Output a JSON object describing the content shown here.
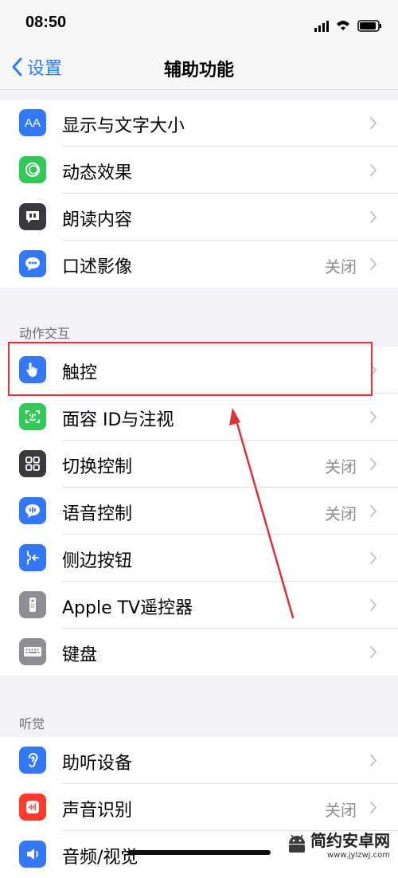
{
  "status": {
    "time": "08:50"
  },
  "nav": {
    "back_label": "设置",
    "title": "辅助功能"
  },
  "vision": {
    "items": [
      {
        "label": "显示与文字大小",
        "value": "",
        "icon": "text-size-icon",
        "color": "#3478f6"
      },
      {
        "label": "动态效果",
        "value": "",
        "icon": "motion-icon",
        "color": "#34c759"
      },
      {
        "label": "朗读内容",
        "value": "",
        "icon": "speech-icon",
        "color": "#3a3a3c"
      },
      {
        "label": "口述影像",
        "value": "关闭",
        "icon": "audio-description-icon",
        "color": "#3478f6"
      }
    ]
  },
  "motor": {
    "header": "动作交互",
    "items": [
      {
        "label": "触控",
        "value": "",
        "icon": "touch-hand-icon",
        "color": "#3478f6"
      },
      {
        "label": "面容 ID与注视",
        "value": "",
        "icon": "face-id-icon",
        "color": "#34c759"
      },
      {
        "label": "切换控制",
        "value": "关闭",
        "icon": "switch-control-icon",
        "color": "#3a3a3c"
      },
      {
        "label": "语音控制",
        "value": "关闭",
        "icon": "voice-control-icon",
        "color": "#3478f6"
      },
      {
        "label": "侧边按钮",
        "value": "",
        "icon": "side-button-icon",
        "color": "#3478f6"
      },
      {
        "label": "Apple TV遥控器",
        "value": "",
        "icon": "tv-remote-icon",
        "color": "#8e8e93"
      },
      {
        "label": "键盘",
        "value": "",
        "icon": "keyboard-icon",
        "color": "#8e8e93"
      }
    ]
  },
  "hearing": {
    "header": "听觉",
    "items": [
      {
        "label": "助听设备",
        "value": "",
        "icon": "ear-icon",
        "color": "#3478f6"
      },
      {
        "label": "声音识别",
        "value": "关闭",
        "icon": "sound-recognition-icon",
        "color": "#ff3b30"
      },
      {
        "label": "音频/视觉",
        "value": "",
        "icon": "speaker-icon",
        "color": "#3478f6"
      }
    ]
  },
  "watermark": {
    "text": "简约安卓网",
    "url": "www.jylzwj.com"
  }
}
